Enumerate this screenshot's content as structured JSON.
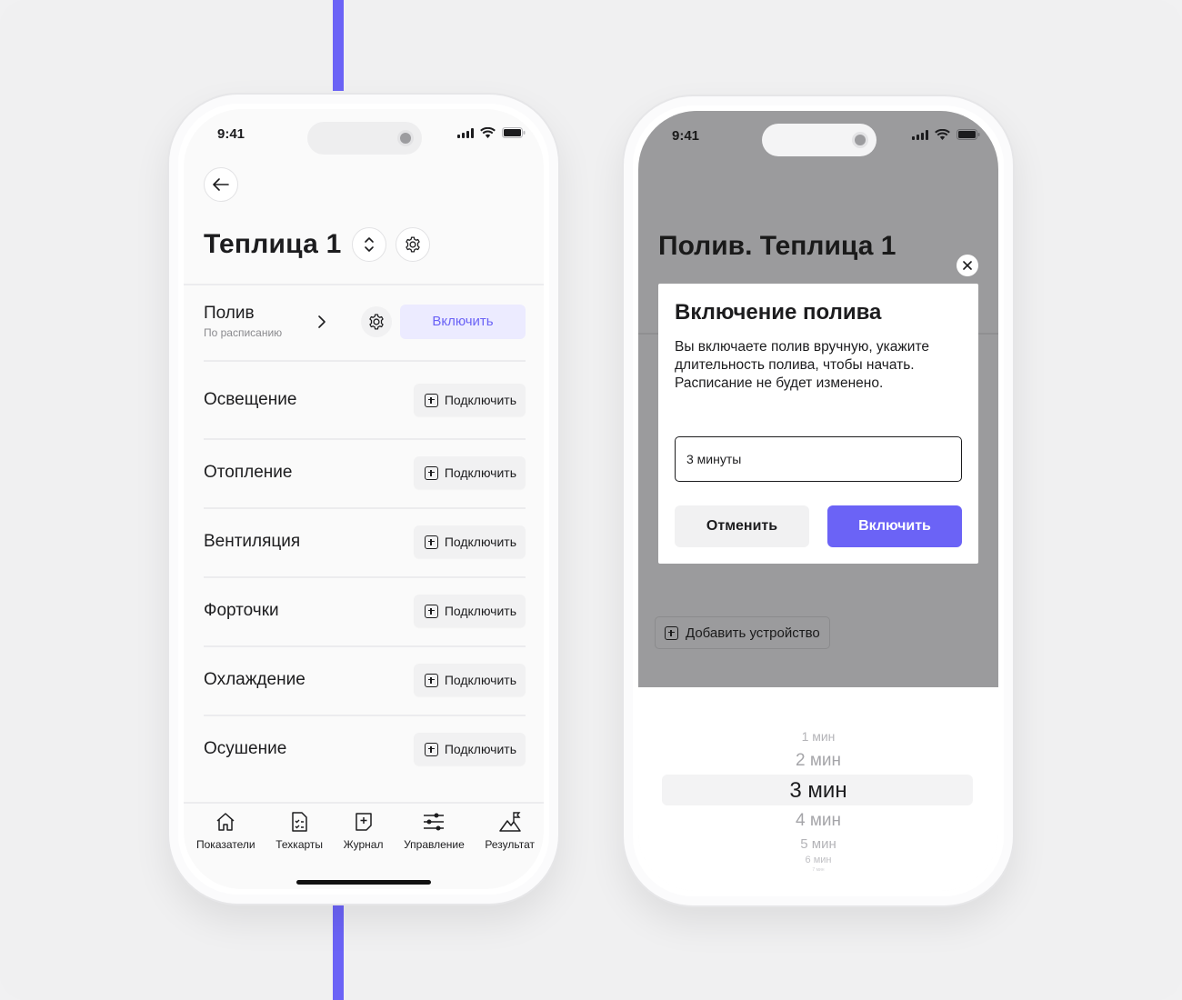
{
  "colors": {
    "accent": "#6b63f6",
    "accent_light": "#ecebff",
    "overlay": "#9b9b9d",
    "background": "#f0f0f1"
  },
  "left_phone": {
    "status_time": "9:41",
    "title": "Теплица 1",
    "icons": {
      "back": "arrow-left-icon",
      "switch": "chevron-up-down-icon",
      "settings": "gear-icon"
    },
    "watering": {
      "name": "Полив",
      "subtitle": "По расписанию",
      "enable_label": "Включить"
    },
    "devices": [
      {
        "name": "Освещение",
        "action": "Подключить"
      },
      {
        "name": "Отопление",
        "action": "Подключить"
      },
      {
        "name": "Вентиляция",
        "action": "Подключить"
      },
      {
        "name": "Форточки",
        "action": "Подключить"
      },
      {
        "name": "Охлаждение",
        "action": "Подключить"
      },
      {
        "name": "Осушение",
        "action": "Подключить"
      }
    ],
    "tabs": [
      {
        "label": "Показатели",
        "icon": "home-icon"
      },
      {
        "label": "Техкарты",
        "icon": "checklist-icon"
      },
      {
        "label": "Журнал",
        "icon": "journal-plus-icon"
      },
      {
        "label": "Управление",
        "icon": "sliders-icon"
      },
      {
        "label": "Результат",
        "icon": "mountain-flag-icon"
      }
    ]
  },
  "right_phone": {
    "status_time": "9:41",
    "background_title": "Полив. Теплица 1",
    "modal": {
      "title": "Включение полива",
      "text": "Вы включаете полив вручную, укажите длительность полива, чтобы начать. Расписание не будет изменено.",
      "input_value": "3 минуты",
      "cancel_label": "Отменить",
      "confirm_label": "Включить"
    },
    "add_device_label": "Добавить устройство",
    "picker": {
      "options": [
        "1 мин",
        "2 мин",
        "3 мин",
        "4 мин",
        "5 мин",
        "6 мин",
        "7 мин"
      ],
      "selected": "3 мин"
    }
  }
}
